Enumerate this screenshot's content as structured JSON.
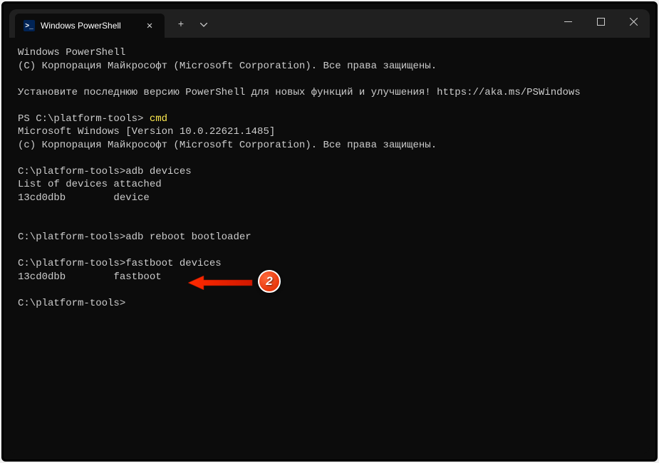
{
  "window": {
    "tab_title": "Windows PowerShell",
    "tab_icon_text": ">_"
  },
  "terminal": {
    "lines": [
      {
        "text": "Windows PowerShell"
      },
      {
        "text": "(C) Корпорация Майкрософт (Microsoft Corporation). Все права защищены."
      },
      {
        "text": ""
      },
      {
        "text": "Установите последнюю версию PowerShell для новых функций и улучшения! https://aka.ms/PSWindows"
      },
      {
        "text": ""
      },
      {
        "prompt": "PS C:\\platform-tools> ",
        "cmd": "cmd",
        "cmd_class": "cmd-yellow"
      },
      {
        "text": "Microsoft Windows [Version 10.0.22621.1485]"
      },
      {
        "text": "(c) Корпорация Майкрософт (Microsoft Corporation). Все права защищены."
      },
      {
        "text": ""
      },
      {
        "prompt": "C:\\platform-tools>",
        "cmd": "adb devices"
      },
      {
        "text": "List of devices attached"
      },
      {
        "text": "13cd0dbb        device"
      },
      {
        "text": ""
      },
      {
        "text": ""
      },
      {
        "prompt": "C:\\platform-tools>",
        "cmd": "adb reboot bootloader"
      },
      {
        "text": ""
      },
      {
        "prompt": "C:\\platform-tools>",
        "cmd": "fastboot devices"
      },
      {
        "text": "13cd0dbb        fastboot"
      },
      {
        "text": ""
      },
      {
        "prompt": "C:\\platform-tools>",
        "cmd": ""
      }
    ]
  },
  "annotation": {
    "badge_number": "2"
  }
}
